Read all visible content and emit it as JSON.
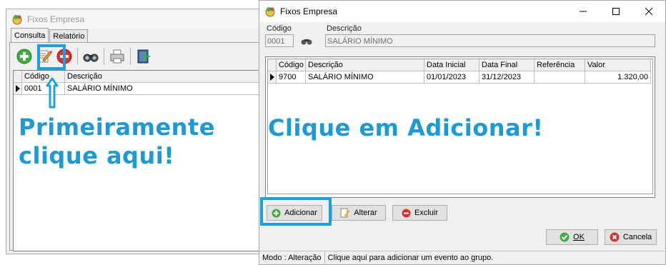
{
  "back_window": {
    "title": "Fixos Empresa",
    "tabs": [
      "Consulta",
      "Relatório"
    ],
    "grid": {
      "columns": [
        "Código",
        "Descrição"
      ],
      "rows": [
        [
          "0001",
          "SALÁRIO MÍNIMO"
        ]
      ]
    },
    "annotation": "Primeiramente clique aqui!",
    "annotation_line1": "Primeiramente",
    "annotation_line2": "clique aqui!"
  },
  "front_window": {
    "title": "Fixos Empresa",
    "codigo_label": "Código",
    "codigo_value": "0001",
    "descricao_label": "Descrição",
    "descricao_value": "SALÁRIO MÍNIMO",
    "grid": {
      "columns": [
        "Código",
        "Descrição",
        "Data Inicial",
        "Data Final",
        "Referência",
        "Valor"
      ],
      "rows": [
        [
          "9700",
          "SALÁRIO MÍNIMO",
          "01/01/2023",
          "31/12/2023",
          "",
          "1.320,00"
        ]
      ]
    },
    "annotation": "Clique em Adicionar!",
    "buttons": {
      "adicionar": "Adicionar",
      "alterar": "Alterar",
      "excluir": "Excluir",
      "ok": "OK",
      "cancela": "Cancela"
    },
    "status": {
      "mode": "Modo : Alteração",
      "hint": "Clique aqui para adicionar um evento ao grupo."
    }
  },
  "colors": {
    "annotation_blue": "#1b9ad6",
    "highlight_border": "#1ba1e2"
  }
}
